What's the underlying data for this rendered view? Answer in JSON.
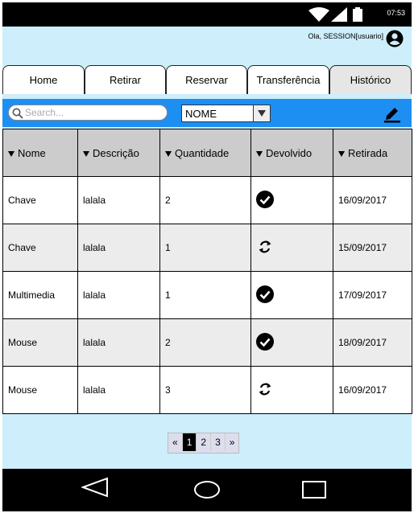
{
  "status": {
    "time": "07:53"
  },
  "header": {
    "greeting": "Ola, SESSION[usuario]"
  },
  "tabs": [
    {
      "label": "Home"
    },
    {
      "label": "Retirar"
    },
    {
      "label": "Reservar"
    },
    {
      "label": "Transferência"
    },
    {
      "label": "Histórico"
    }
  ],
  "toolbar": {
    "search_placeholder": "Search...",
    "filter_value": "NOME"
  },
  "table": {
    "columns": [
      "Nome",
      "Descrição",
      "Quantidade",
      "Devolvido",
      "Retirada"
    ],
    "rows": [
      {
        "nome": "Chave",
        "descricao": "lalala",
        "quantidade": "2",
        "devolvido": "check-circle-icon",
        "retirada": "16/09/2017"
      },
      {
        "nome": "Chave",
        "descricao": "lalala",
        "quantidade": "1",
        "devolvido": "refresh-icon",
        "retirada": "15/09/2017"
      },
      {
        "nome": "Multimedia",
        "descricao": "lalala",
        "quantidade": "1",
        "devolvido": "check-circle-icon",
        "retirada": "17/09/2017"
      },
      {
        "nome": "Mouse",
        "descricao": "lalala",
        "quantidade": "2",
        "devolvido": "check-circle-icon",
        "retirada": "18/09/2017"
      },
      {
        "nome": "Mouse",
        "descricao": "lalala",
        "quantidade": "3",
        "devolvido": "refresh-icon",
        "retirada": "16/09/2017"
      }
    ]
  },
  "pagination": {
    "prev": "«",
    "pages": [
      "1",
      "2",
      "3"
    ],
    "current": "1",
    "next": "»"
  },
  "colors": {
    "background": "#cdeefa",
    "toolbar": "#1e8ff2",
    "header_cell": "#cccccc"
  }
}
